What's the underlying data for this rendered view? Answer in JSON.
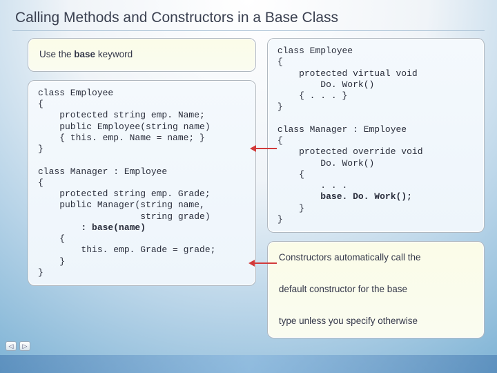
{
  "title": "Calling Methods and Constructors in a Base Class",
  "left": {
    "keyword_box_html": "Use the <b>base</b> keyword",
    "code1_html": "class Employee\n{\n    protected string emp. Name;\n    public Employee(string name)\n    { this. emp. Name = name; }\n}\n\nclass Manager : Employee\n{\n    protected string emp. Grade;\n    public Manager(string name,\n                   string grade)\n        <b>: base(name)</b>\n    {\n        this. emp. Grade = grade;\n    }\n}"
  },
  "right": {
    "code2_html": "class Employee\n{\n    protected virtual void\n        Do. Work()\n    { . . . }\n}\n\nclass Manager : Employee\n{\n    protected override void\n        Do. Work()\n    {\n        . . .\n        <b>base. Do. Work();</b>\n    }\n}",
    "note_html": "Constructors automatically call the\n\ndefault constructor for the base\n\ntype unless you specify otherwise"
  },
  "nav": {
    "prev": "◁",
    "next": "▷"
  }
}
